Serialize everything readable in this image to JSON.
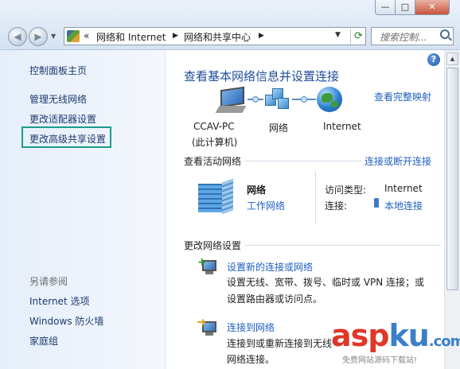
{
  "nav": {
    "crumb_prefix": "«",
    "crumbs": [
      "网络和 Internet",
      "网络和共享中心"
    ],
    "search_placeholder": "搜索控制...",
    "window_buttons": {
      "minimize": "—",
      "maximize": "□",
      "close": "✕"
    }
  },
  "sidebar": {
    "home": "控制面板主页",
    "items": [
      {
        "label": "管理无线网络"
      },
      {
        "label": "更改适配器设置"
      },
      {
        "label": "更改高级共享设置"
      }
    ],
    "see_also_title": "另请参阅",
    "see_also": [
      {
        "label": "Internet 选项"
      },
      {
        "label": "Windows 防火墙"
      },
      {
        "label": "家庭组"
      }
    ]
  },
  "main": {
    "title": "查看基本网络信息并设置连接",
    "full_map_link": "查看完整映射",
    "map": {
      "computer_name": "CCAV-PC",
      "computer_sub": "(此计算机)",
      "network": "网络",
      "internet": "Internet"
    },
    "active": {
      "header": "查看活动网络",
      "connect_link": "连接或断开连接",
      "network_name": "网络",
      "network_type": "工作网络",
      "access_type_label": "访问类型:",
      "access_type_value": "Internet",
      "connections_label": "连接:",
      "connections_value": "本地连接"
    },
    "change": {
      "header": "更改网络设置",
      "tasks": [
        {
          "link": "设置新的连接或网络",
          "desc1": "设置无线、宽带、拨号、临时或 VPN 连接；或",
          "desc2": "设置路由器或访问点。"
        },
        {
          "link": "连接到网络",
          "desc1": "连接到或重新连接到无线",
          "desc2": "网络连接。"
        }
      ]
    }
  },
  "watermark": {
    "asp": "asp",
    "ku": "ku",
    "com": ".com",
    "sub": "免费网站源码下载站!"
  },
  "colors": {
    "accent": "#1e5fbf",
    "title": "#1e4d98",
    "highlight": "#1a9c8b"
  }
}
